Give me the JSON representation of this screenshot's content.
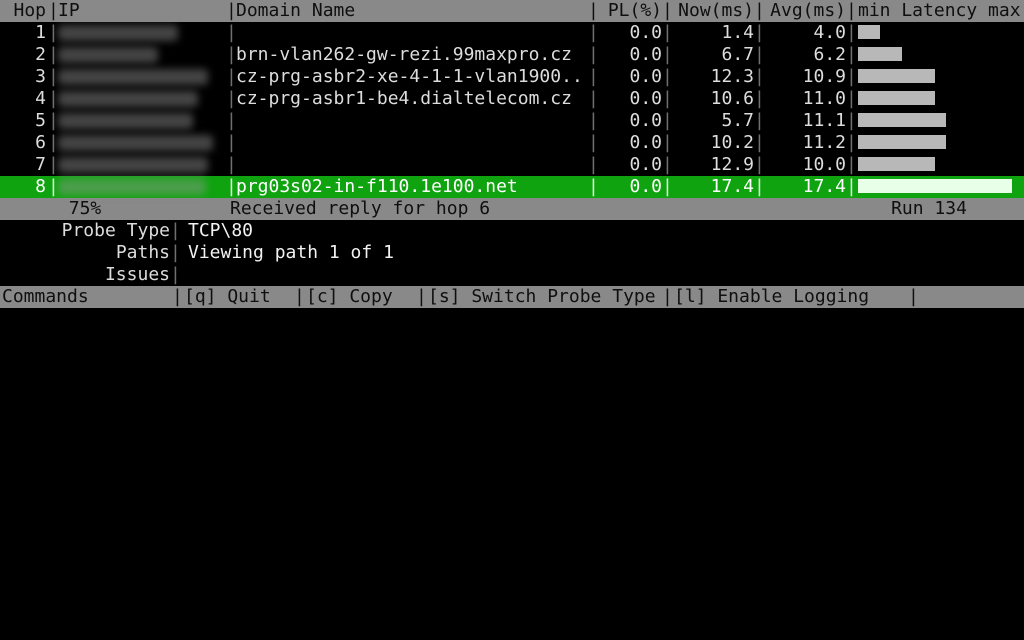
{
  "columns": {
    "hop": "Hop",
    "ip": "IP",
    "domain": "Domain Name",
    "pl": "PL(%)",
    "now": "Now(ms)",
    "avg": "Avg(ms)",
    "latency": "min Latency max"
  },
  "hops": [
    {
      "n": "1",
      "ip_hidden": true,
      "ip_w": "1",
      "domain": "",
      "pl": "0.0",
      "now": "1.4",
      "avg": "4.0",
      "bar": 2,
      "selected": false
    },
    {
      "n": "2",
      "ip_hidden": true,
      "ip_w": "2",
      "domain": "brn-vlan262-gw-rezi.99maxpro.cz",
      "pl": "0.0",
      "now": "6.7",
      "avg": "6.2",
      "bar": 4,
      "selected": false
    },
    {
      "n": "3",
      "ip_hidden": true,
      "ip_w": "3",
      "domain": "cz-prg-asbr2-xe-4-1-1-vlan1900..",
      "pl": "0.0",
      "now": "12.3",
      "avg": "10.9",
      "bar": 7,
      "selected": false
    },
    {
      "n": "4",
      "ip_hidden": true,
      "ip_w": "4",
      "domain": "cz-prg-asbr1-be4.dialtelecom.cz",
      "pl": "0.0",
      "now": "10.6",
      "avg": "11.0",
      "bar": 7,
      "selected": false
    },
    {
      "n": "5",
      "ip_hidden": true,
      "ip_w": "5",
      "domain": "",
      "pl": "0.0",
      "now": "5.7",
      "avg": "11.1",
      "bar": 8,
      "selected": false
    },
    {
      "n": "6",
      "ip_hidden": true,
      "ip_w": "6",
      "domain": "",
      "pl": "0.0",
      "now": "10.2",
      "avg": "11.2",
      "bar": 8,
      "selected": false
    },
    {
      "n": "7",
      "ip_hidden": true,
      "ip_w": "7",
      "domain": "",
      "pl": "0.0",
      "now": "12.9",
      "avg": "10.0",
      "bar": 7,
      "selected": false
    },
    {
      "n": "8",
      "ip_hidden": true,
      "ip_w": "8",
      "domain": "prg03s02-in-f110.1e100.net",
      "pl": "0.0",
      "now": "17.4",
      "avg": "17.4",
      "bar": 14,
      "selected": true
    }
  ],
  "status": {
    "percent": "75%",
    "message": "Received reply for hop 6",
    "run": "Run 134"
  },
  "info": {
    "probe_label": "Probe Type",
    "probe_value": "TCP\\80",
    "paths_label": "Paths",
    "paths_value": "Viewing path 1 of 1",
    "issues_label": "Issues",
    "issues_value": ""
  },
  "commands": {
    "label": "Commands",
    "quit": "[q] Quit",
    "copy": "[c] Copy",
    "switch": "[s] Switch Probe Type",
    "log": "[l] Enable Logging"
  },
  "colors": {
    "header_bg": "#898989",
    "selected_bg": "#0fa30f"
  }
}
